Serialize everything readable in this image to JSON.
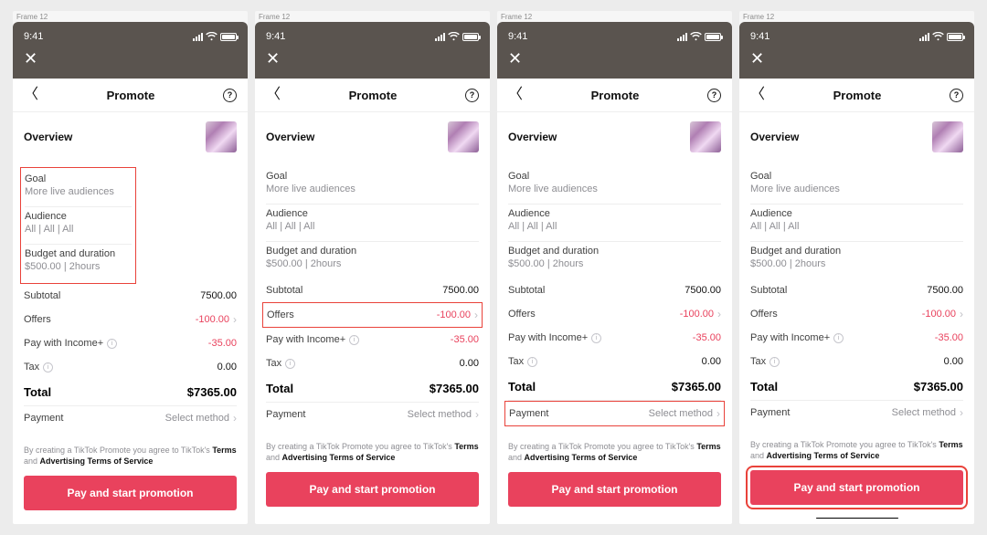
{
  "frame_label": "Frame 12",
  "status": {
    "time": "9:41"
  },
  "nav": {
    "title": "Promote",
    "help": "?"
  },
  "overview_label": "Overview",
  "settings": [
    {
      "title": "Goal",
      "value": "More live audiences"
    },
    {
      "title": "Audience",
      "value": "All | All | All"
    },
    {
      "title": "Budget and duration",
      "value": "$500.00 | 2hours"
    }
  ],
  "rows": {
    "subtotal": {
      "label": "Subtotal",
      "value": "7500.00"
    },
    "offers": {
      "label": "Offers",
      "value": "-100.00"
    },
    "income": {
      "label": "Pay with Income+",
      "value": "-35.00"
    },
    "tax": {
      "label": "Tax",
      "value": "0.00"
    },
    "total": {
      "label": "Total",
      "value": "$7365.00"
    },
    "payment": {
      "label": "Payment",
      "value": "Select method"
    }
  },
  "legal": {
    "pre": "By creating a TikTok Promote you agree to TikTok's ",
    "terms": "Terms",
    "mid": " and ",
    "adv": "Advertising Terms of Service"
  },
  "cta_label": "Pay and start promotion",
  "highlights": [
    "hl-settings",
    "hl-offers",
    "hl-payment",
    "hl-cta"
  ]
}
